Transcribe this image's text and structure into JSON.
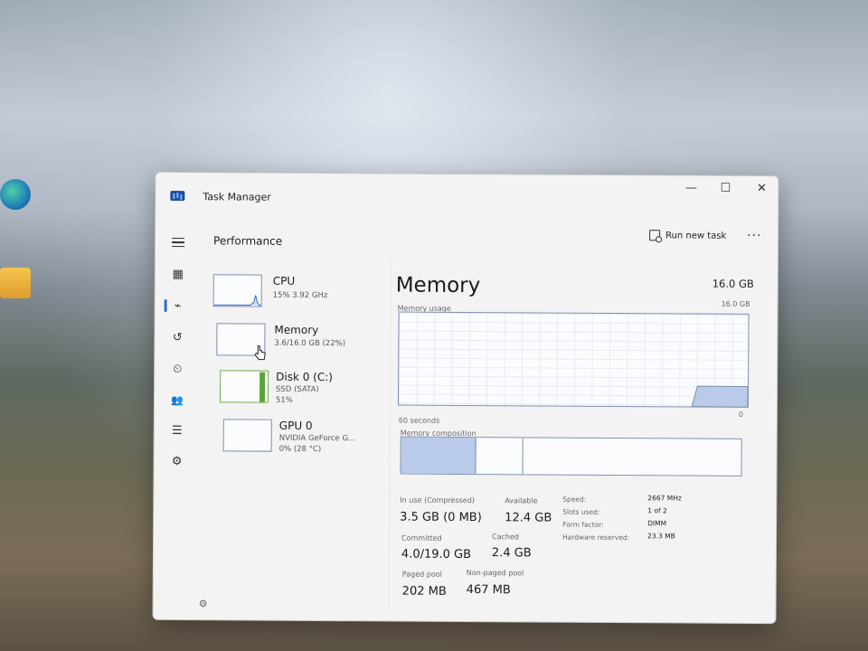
{
  "window": {
    "app_title": "Task Manager",
    "minimize": "—",
    "maximize": "☐",
    "close": "✕"
  },
  "toolbar": {
    "page_title": "Performance",
    "run_new_task": "Run new task",
    "more": "···"
  },
  "nav": [
    {
      "icon": "hamburger-icon"
    },
    {
      "icon": "processes-icon",
      "glyph": "▦"
    },
    {
      "icon": "performance-icon",
      "glyph": "⌁",
      "active": true
    },
    {
      "icon": "app-history-icon",
      "glyph": "↺"
    },
    {
      "icon": "startup-apps-icon",
      "glyph": "⏲"
    },
    {
      "icon": "users-icon",
      "glyph": "👥"
    },
    {
      "icon": "details-icon",
      "glyph": "☰"
    },
    {
      "icon": "services-icon",
      "glyph": "⚙"
    }
  ],
  "resources": [
    {
      "name": "CPU",
      "sub1": "15% 3.92 GHz",
      "sub2": "",
      "color": "#2b6cd4",
      "fill": 0.15
    },
    {
      "name": "Memory",
      "sub1": "3.6/16.0 GB (22%)",
      "sub2": "",
      "color": "#7b8fb5",
      "fill": 0.22
    },
    {
      "name": "Disk 0 (C:)",
      "sub1": "SSD (SATA)",
      "sub2": "51%",
      "color": "#5aa53a",
      "fill": 0.51
    },
    {
      "name": "GPU 0",
      "sub1": "NVIDIA GeForce G...",
      "sub2": "0% (28 °C)",
      "color": "#7b8fb5",
      "fill": 0.0
    }
  ],
  "memory": {
    "title": "Memory",
    "total": "16.0 GB",
    "graph_max": "16.0 GB",
    "usage_label": "Memory usage",
    "time_label": "60 seconds",
    "graph_min": "0",
    "composition_label": "Memory composition",
    "composition": {
      "in_use": 0.22,
      "modified": 0.14,
      "standby": 0.64
    },
    "stats": {
      "in_use_label": "In use (Compressed)",
      "in_use_value": "3.5 GB (0 MB)",
      "available_label": "Available",
      "available_value": "12.4 GB",
      "committed_label": "Committed",
      "committed_value": "4.0/19.0 GB",
      "cached_label": "Cached",
      "cached_value": "2.4 GB",
      "paged_label": "Paged pool",
      "paged_value": "202 MB",
      "nonpaged_label": "Non-paged pool",
      "nonpaged_value": "467 MB"
    },
    "details": [
      {
        "label": "Speed:",
        "value": "2667 MHz"
      },
      {
        "label": "Slots used:",
        "value": "1 of 2"
      },
      {
        "label": "Form factor:",
        "value": "DIMM"
      },
      {
        "label": "Hardware reserved:",
        "value": "23.3 MB"
      }
    ]
  },
  "colors": {
    "accent": "#2b6cd4",
    "memory_line": "#7b8fb5",
    "memory_fill": "#b9cbe9"
  }
}
